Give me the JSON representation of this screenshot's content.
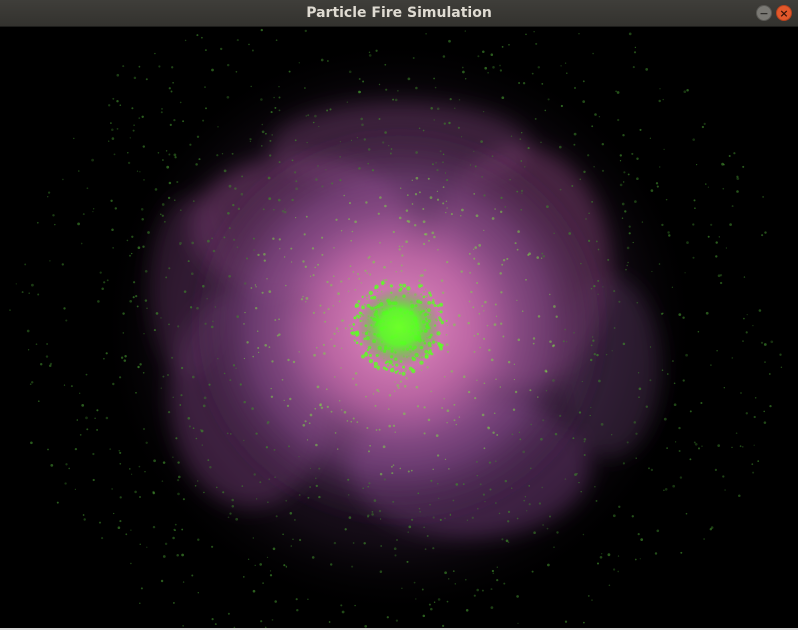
{
  "window": {
    "title": "Particle Fire Simulation"
  },
  "controls": {
    "minimize_icon": "minimize-icon",
    "close_icon": "close-icon",
    "minimize_glyph": "−",
    "close_glyph": "×"
  },
  "colors": {
    "titlebar": "#3a3935",
    "title_text": "#dfdbd2",
    "close_button": "#e2582b",
    "minimize_button": "#7a7974",
    "canvas_background": "#000000",
    "particle_core": "#55ff22",
    "nebula_pink": "#e060c0",
    "nebula_purple": "#8a4aa0"
  }
}
